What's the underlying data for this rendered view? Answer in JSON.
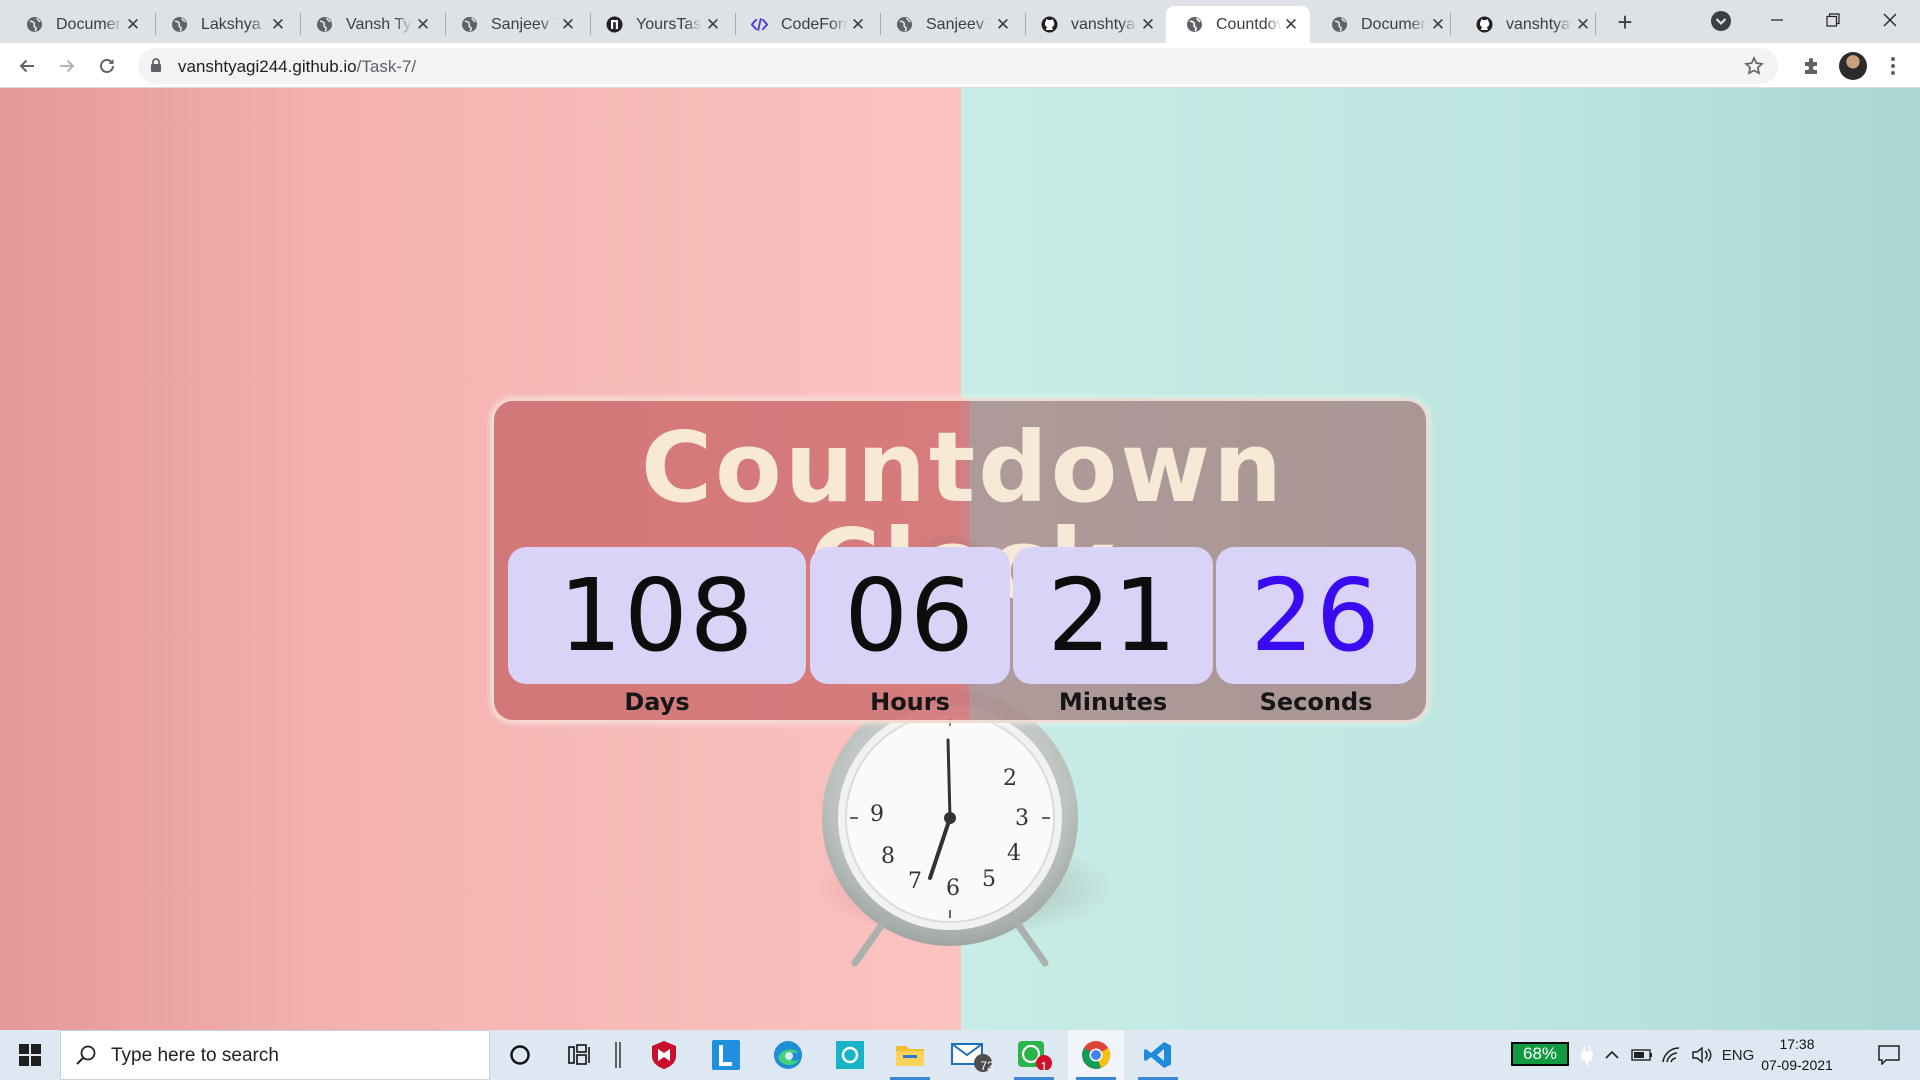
{
  "browser": {
    "tabs": [
      {
        "title": "Documen",
        "icon": "globe-icon",
        "active": false
      },
      {
        "title": "Lakshya",
        "icon": "globe-icon",
        "active": false
      },
      {
        "title": "Vansh Tya",
        "icon": "globe-icon",
        "active": false
      },
      {
        "title": "Sanjeev T",
        "icon": "globe-icon",
        "active": false
      },
      {
        "title": "YoursTast",
        "icon": "yourstasty-icon",
        "active": false
      },
      {
        "title": "CodeForm",
        "icon": "code-icon",
        "active": false
      },
      {
        "title": "Sanjeev T",
        "icon": "globe-icon",
        "active": false
      },
      {
        "title": "vanshtyag",
        "icon": "github-icon",
        "active": false
      },
      {
        "title": "Countdov",
        "icon": "globe-icon",
        "active": true
      },
      {
        "title": "Documen",
        "icon": "globe-icon",
        "active": false
      },
      {
        "title": "vanshtyag",
        "icon": "github-icon",
        "active": false
      }
    ],
    "address": {
      "host": "vanshtyagi244.github.io",
      "path": "/Task-7/"
    }
  },
  "page": {
    "title": "Countdown Clock",
    "units": [
      {
        "value": "108",
        "label": "Days"
      },
      {
        "value": "06",
        "label": "Hours"
      },
      {
        "value": "21",
        "label": "Minutes"
      },
      {
        "value": "26",
        "label": "Seconds"
      }
    ],
    "accent_seconds_color": "#3a0bf0",
    "card_text_color": "#f8e8d6",
    "alarm_clock_numerals": [
      "2",
      "3",
      "4",
      "5",
      "6",
      "7",
      "8",
      "9"
    ]
  },
  "taskbar": {
    "search_placeholder": "Type here to search",
    "mail_badge": "72",
    "whatsapp_badge": "1",
    "battery_percent": "68%",
    "language": "ENG",
    "time": "17:38",
    "date": "07-09-2021"
  }
}
